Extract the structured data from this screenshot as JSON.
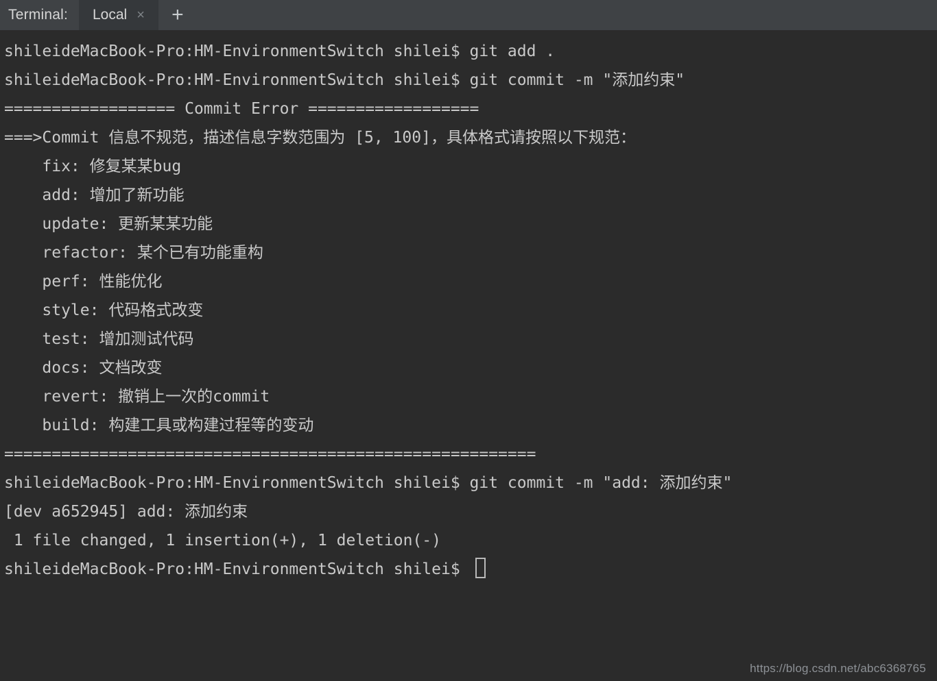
{
  "tabbar": {
    "terminal_label": "Terminal:",
    "active_tab": "Local",
    "close_icon": "×",
    "add_icon": "+"
  },
  "terminal": {
    "prompt": "shileideMacBook-Pro:HM-EnvironmentSwitch shilei$ ",
    "lines": [
      "shileideMacBook-Pro:HM-EnvironmentSwitch shilei$ git add .",
      "shileideMacBook-Pro:HM-EnvironmentSwitch shilei$ git commit -m \"添加约束\"",
      "================== Commit Error ==================",
      "===>Commit 信息不规范，描述信息字数范围为 [5, 100]，具体格式请按照以下规范：",
      "    fix: 修复某某bug",
      "    add: 增加了新功能",
      "    update: 更新某某功能",
      "    refactor: 某个已有功能重构",
      "    perf: 性能优化",
      "    style: 代码格式改变",
      "    test: 增加测试代码",
      "    docs: 文档改变",
      "    revert: 撤销上一次的commit",
      "    build: 构建工具或构建过程等的变动",
      "========================================================",
      "shileideMacBook-Pro:HM-EnvironmentSwitch shilei$ git commit -m \"add: 添加约束\"",
      "[dev a652945] add: 添加约束",
      " 1 file changed, 1 insertion(+), 1 deletion(-)",
      "shileideMacBook-Pro:HM-EnvironmentSwitch shilei$ "
    ],
    "cursor_line_index": 18
  },
  "watermark": {
    "text": "https://blog.csdn.net/abc6368765"
  },
  "colors": {
    "terminal_bg": "#2b2b2b",
    "tabbar_bg": "#3f4245",
    "active_tab_bg": "#35383b",
    "text": "#c9c9c9",
    "watermark": "#8d9196"
  }
}
